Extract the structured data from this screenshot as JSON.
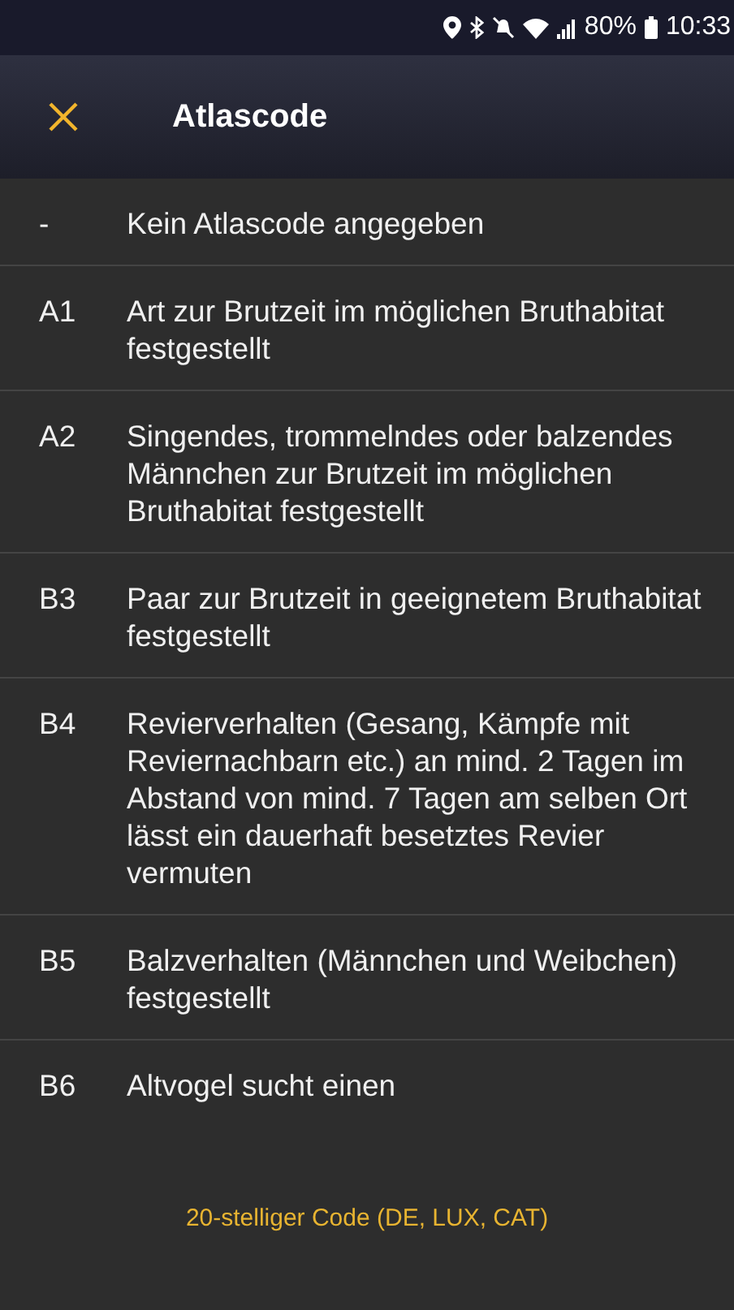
{
  "status_bar": {
    "battery_percent": "80%",
    "time": "10:33"
  },
  "app_bar": {
    "title": "Atlascode"
  },
  "codes": [
    {
      "code": "-",
      "description": "Kein Atlascode angegeben"
    },
    {
      "code": "A1",
      "description": "Art zur Brutzeit im möglichen Bruthabitat festgestellt"
    },
    {
      "code": "A2",
      "description": "Singendes, trommelndes oder balzendes Männchen zur Brutzeit im möglichen Bruthabitat festgestellt"
    },
    {
      "code": "B3",
      "description": "Paar zur Brutzeit in geeignetem Bruthabitat festgestellt"
    },
    {
      "code": "B4",
      "description": "Revierverhalten (Gesang, Kämpfe mit Reviernachbarn etc.) an mind. 2 Tagen im Abstand von mind. 7 Tagen am selben Ort lässt ein dauerhaft besetztes Revier vermuten"
    },
    {
      "code": "B5",
      "description": "Balzverhalten (Männchen und Weibchen) festgestellt"
    },
    {
      "code": "B6",
      "description": "Altvogel sucht einen"
    }
  ],
  "footer_button": {
    "label": "20-stelliger Code (DE, LUX, CAT)"
  }
}
